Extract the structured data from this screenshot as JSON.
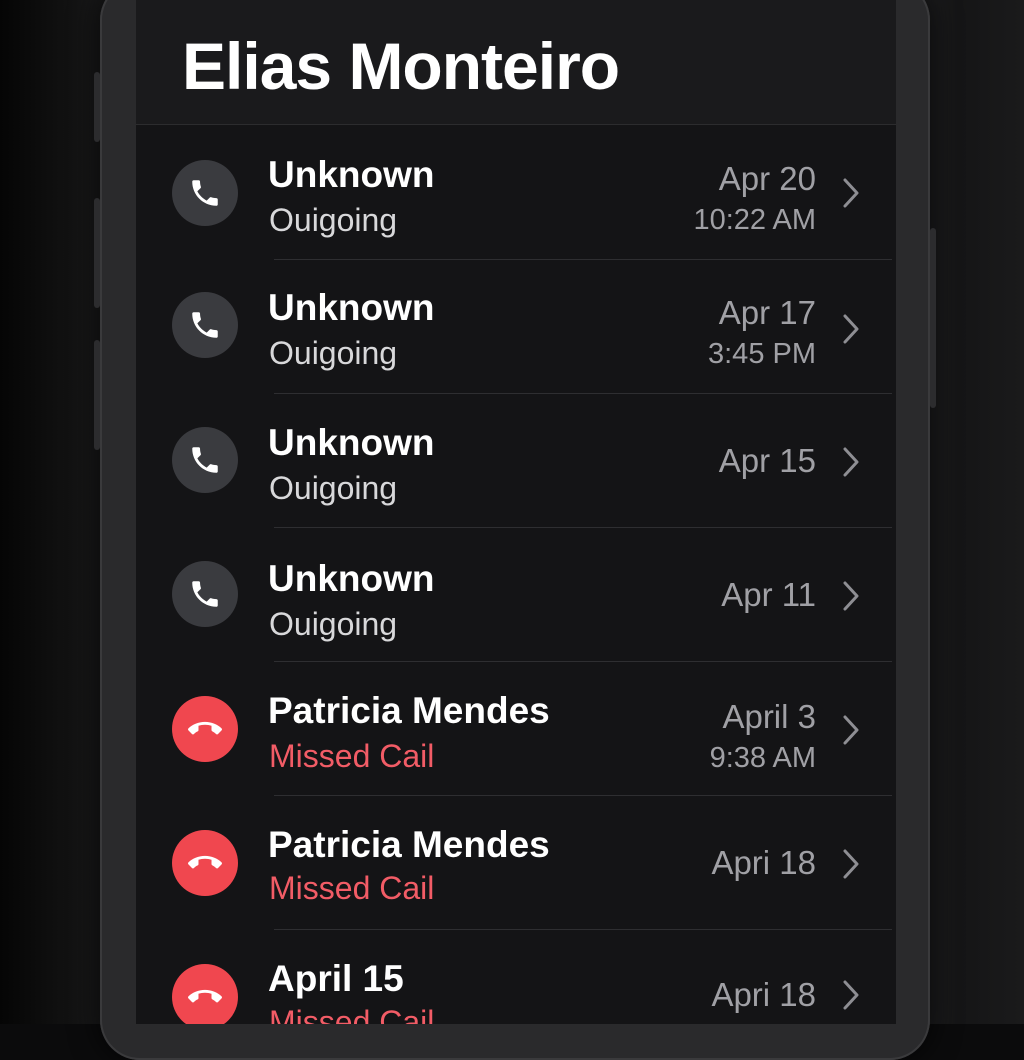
{
  "contact": {
    "title": "Elias Monteiro"
  },
  "calls": [
    {
      "name": "Unknown",
      "type": "Ouigoing",
      "kind": "outgoing",
      "date": "Apr  20",
      "time": "10:22 AM",
      "icon": "phone-icon"
    },
    {
      "name": "Unknown",
      "type": "Ouigoing",
      "kind": "outgoing",
      "date": "Apr   17",
      "time": "3:45 PM",
      "icon": "phone-icon"
    },
    {
      "name": "Unknown",
      "type": "Ouigoing",
      "kind": "outgoing",
      "date": "Apr 15",
      "time": "",
      "icon": "phone-icon"
    },
    {
      "name": "Unknown",
      "type": "Ouigoing",
      "kind": "outgoing",
      "date": "Apr 11",
      "time": "",
      "icon": "phone-icon"
    },
    {
      "name": "Patricia Mendes",
      "type": "Missed Cail",
      "kind": "missed",
      "date": "April 3",
      "time": "9:38 AM",
      "icon": "hang-up-phone-icon"
    },
    {
      "name": "Patricia Mendes",
      "type": "Missed Cail",
      "kind": "missed",
      "date": "Apri 18",
      "time": "",
      "icon": "hang-up-phone-icon"
    },
    {
      "name": "April 15",
      "type": "Missed Cail",
      "kind": "missed",
      "date": "Apri 18",
      "time": "",
      "icon": "hang-up-phone-icon"
    }
  ],
  "colors": {
    "missed_accent": "#f0474f",
    "missed_text": "#f25c66",
    "outgoing_avatar": "#3a3b3f",
    "background": "#141416"
  }
}
